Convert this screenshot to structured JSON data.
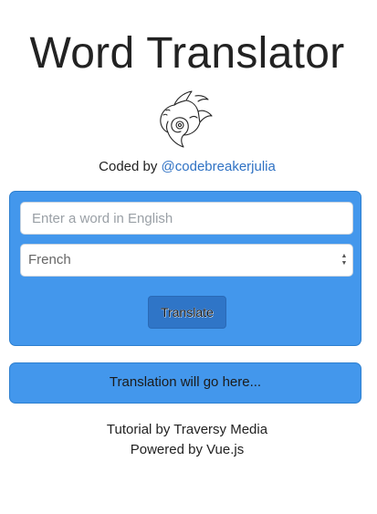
{
  "header": {
    "title": "Word Translator",
    "logo": "swirl-fish-logo"
  },
  "credit": {
    "prefix": "Coded by",
    "author_link": "@codebreakerjulia"
  },
  "form": {
    "word_placeholder": "Enter a word in English",
    "word_value": "",
    "language_selected": "French",
    "translate_label": "Translate"
  },
  "result": {
    "text": "Translation will go here..."
  },
  "footer": {
    "tutorial": "Tutorial by Traversy Media",
    "powered": "Powered by Vue.js"
  },
  "colors": {
    "panel": "#4397ec",
    "panel_border": "#2d7fcf",
    "button": "#2f75c7",
    "link": "#2f72c4"
  }
}
